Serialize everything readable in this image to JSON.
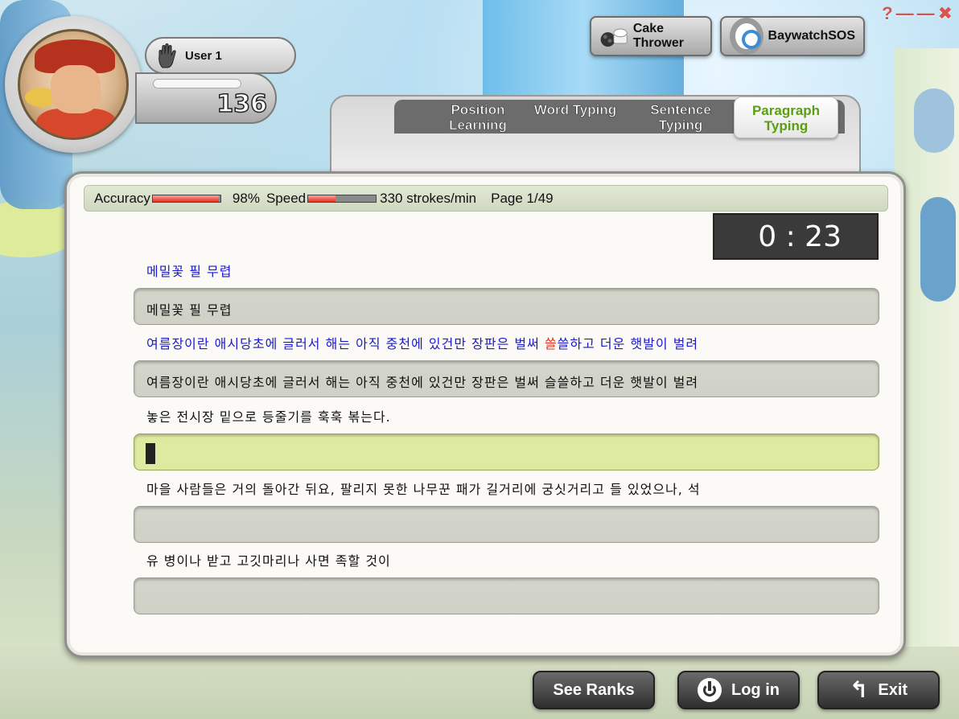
{
  "window": {
    "controls": [
      "?",
      "—",
      "—",
      "✖"
    ]
  },
  "user": {
    "name": "User 1",
    "score": "136"
  },
  "games": [
    {
      "label": "Cake Thrower",
      "icon": "cake-icon"
    },
    {
      "label": "BaywatchSOS",
      "icon": "lifebuoy-icon"
    }
  ],
  "tabs": [
    {
      "label": "Position Learning",
      "active": false
    },
    {
      "label": "Word Typing",
      "active": false
    },
    {
      "label": "Sentence Typing",
      "active": false
    },
    {
      "label": "Paragraph Typing",
      "active": true
    }
  ],
  "stats": {
    "accuracy_label": "Accuracy",
    "accuracy_value": "98%",
    "accuracy_level": 0.98,
    "speed_label": "Speed",
    "speed_value": "330 strokes/min",
    "speed_level": 0.4,
    "page": "Page 1/49"
  },
  "timer": "0 : 23",
  "lines": [
    {
      "source": "메밀꽃 필 무렵",
      "typed": "메밀꽃 필 무렵"
    },
    {
      "source_pre": "여름장이란 애시당초에 글러서 해는 아직 중천에 있건만 장판은 벌써 ",
      "source_err": "쓸",
      "source_post": "쓸하고 더운 햇발이 벌려",
      "typed": "여름장이란 애시당초에 글러서 해는 아직 중천에 있건만 장판은 벌써 슬쓸하고 더운 햇발이 벌려"
    },
    {
      "source": "놓은 전시장 밑으로 등줄기를 훅훅 볶는다.",
      "typed": ""
    },
    {
      "source": "마을 사람들은 거의 돌아간 뒤요, 팔리지 못한 나무꾼 패가 길거리에 궁싯거리고 들 있었으나, 석",
      "typed": ""
    },
    {
      "source": "유 병이나 받고 고깃마리나 사면 족할 것이",
      "typed": ""
    }
  ],
  "buttons": {
    "ranks": "See Ranks",
    "login": "Log in",
    "exit": "Exit"
  },
  "colors": {
    "source_text": "#1a1acc",
    "error_text": "#e03020",
    "active_input": "#dfeaa1",
    "paragraph_tab": "#5a9e12"
  }
}
